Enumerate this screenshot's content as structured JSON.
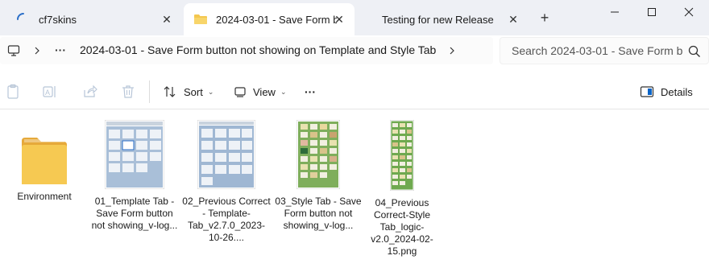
{
  "tabs": [
    {
      "label": "cf7skins",
      "close": "✕",
      "active": false
    },
    {
      "label": "2024-03-01 - Save Form b",
      "close": "✕",
      "active": true
    },
    {
      "label": "Testing for new Release",
      "close": "✕",
      "active": false
    }
  ],
  "new_tab": "+",
  "window_controls": {
    "minimize": "—",
    "maximize": "☐",
    "close": "✕"
  },
  "address": {
    "ellipsis": "···",
    "path": "2024-03-01 - Save Form button not showing on Template and Style Tab",
    "search_placeholder": "Search 2024-03-01 - Save Form b"
  },
  "toolbar": {
    "sort_label": "Sort",
    "view_label": "View",
    "more_label": "···",
    "details_label": "Details"
  },
  "files": [
    {
      "name": "Environment",
      "type": "folder"
    },
    {
      "name": "01_Template Tab - Save Form button not showing_v-log...",
      "type": "image"
    },
    {
      "name": "02_Previous Correct - Template-Tab_v2.7.0_2023-10-26....",
      "type": "image"
    },
    {
      "name": "03_Style Tab - Save Form button not showing_v-log...",
      "type": "image"
    },
    {
      "name": "04_Previous Correct-Style Tab_logic-v2.0_2024-02-15.png",
      "type": "image"
    }
  ],
  "colors": {
    "titlebar_bg": "#eef0f5",
    "folder_yellow": "#f4c74f",
    "accent_blue": "#0a64c8"
  }
}
